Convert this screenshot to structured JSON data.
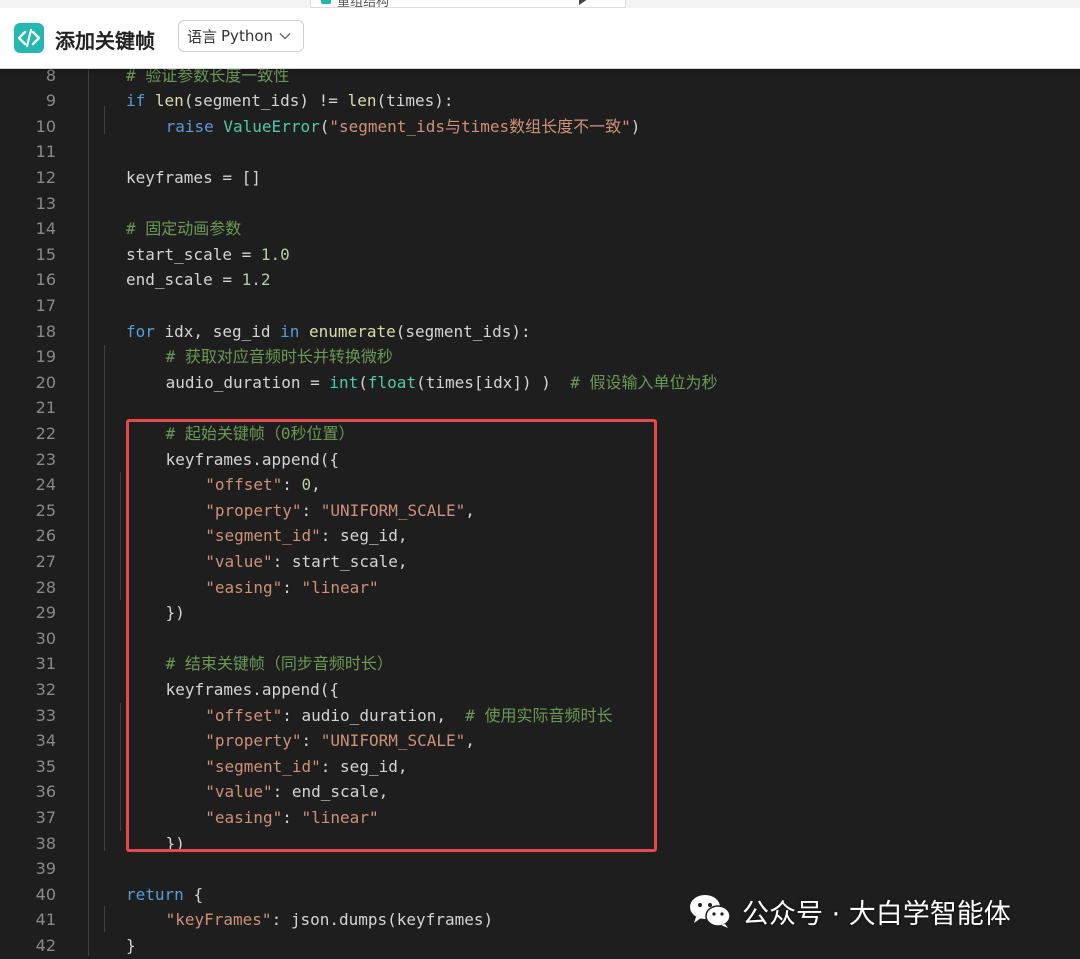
{
  "top_tab": {
    "label": "重组结构"
  },
  "header": {
    "title": "添加关键帧",
    "language_selector": {
      "label": "语言",
      "value": "Python"
    }
  },
  "code_lines": [
    {
      "no": "8",
      "indent": 0,
      "tokens": [
        [
          "cm",
          "# 验证参数长度一致性"
        ]
      ]
    },
    {
      "no": "9",
      "indent": 0,
      "tokens": [
        [
          "kw",
          "if "
        ],
        [
          "fn",
          "len"
        ],
        [
          "tx",
          "(segment_ids) != "
        ],
        [
          "fn",
          "len"
        ],
        [
          "tx",
          "(times):"
        ]
      ]
    },
    {
      "no": "10",
      "indent": 1,
      "tokens": [
        [
          "kw",
          "raise "
        ],
        [
          "cls",
          "ValueError"
        ],
        [
          "tx",
          "("
        ],
        [
          "str",
          "\"segment_ids与times数组长度不一致\""
        ],
        [
          "tx",
          ")"
        ]
      ]
    },
    {
      "no": "11",
      "indent": 0,
      "tokens": []
    },
    {
      "no": "12",
      "indent": 0,
      "tokens": [
        [
          "tx",
          "keyframes = []"
        ]
      ]
    },
    {
      "no": "13",
      "indent": 0,
      "tokens": []
    },
    {
      "no": "14",
      "indent": 0,
      "tokens": [
        [
          "cm",
          "# 固定动画参数"
        ]
      ]
    },
    {
      "no": "15",
      "indent": 0,
      "tokens": [
        [
          "tx",
          "start_scale = "
        ],
        [
          "num",
          "1.0"
        ]
      ]
    },
    {
      "no": "16",
      "indent": 0,
      "tokens": [
        [
          "tx",
          "end_scale = "
        ],
        [
          "num",
          "1.2"
        ]
      ]
    },
    {
      "no": "17",
      "indent": 0,
      "tokens": []
    },
    {
      "no": "18",
      "indent": 0,
      "tokens": [
        [
          "kw",
          "for "
        ],
        [
          "tx",
          "idx, seg_id "
        ],
        [
          "kw",
          "in "
        ],
        [
          "fn",
          "enumerate"
        ],
        [
          "tx",
          "(segment_ids):"
        ]
      ]
    },
    {
      "no": "19",
      "indent": 1,
      "tokens": [
        [
          "cm",
          "# 获取对应音频时长并转换微秒"
        ]
      ]
    },
    {
      "no": "20",
      "indent": 1,
      "tokens": [
        [
          "tx",
          "audio_duration = "
        ],
        [
          "cls",
          "int"
        ],
        [
          "tx",
          "("
        ],
        [
          "cls",
          "float"
        ],
        [
          "tx",
          "(times[idx]) )  "
        ],
        [
          "cm",
          "# 假设输入单位为秒"
        ]
      ]
    },
    {
      "no": "21",
      "indent": 0,
      "tokens": []
    },
    {
      "no": "22",
      "indent": 1,
      "tokens": [
        [
          "cm",
          "# 起始关键帧（0秒位置）"
        ]
      ]
    },
    {
      "no": "23",
      "indent": 1,
      "tokens": [
        [
          "tx",
          "keyframes.append({"
        ]
      ]
    },
    {
      "no": "24",
      "indent": 2,
      "tokens": [
        [
          "str",
          "\"offset\""
        ],
        [
          "tx",
          ": "
        ],
        [
          "num",
          "0"
        ],
        [
          "tx",
          ","
        ]
      ]
    },
    {
      "no": "25",
      "indent": 2,
      "tokens": [
        [
          "str",
          "\"property\""
        ],
        [
          "tx",
          ": "
        ],
        [
          "str",
          "\"UNIFORM_SCALE\""
        ],
        [
          "tx",
          ","
        ]
      ]
    },
    {
      "no": "26",
      "indent": 2,
      "tokens": [
        [
          "str",
          "\"segment_id\""
        ],
        [
          "tx",
          ": seg_id,"
        ]
      ]
    },
    {
      "no": "27",
      "indent": 2,
      "tokens": [
        [
          "str",
          "\"value\""
        ],
        [
          "tx",
          ": start_scale,"
        ]
      ]
    },
    {
      "no": "28",
      "indent": 2,
      "tokens": [
        [
          "str",
          "\"easing\""
        ],
        [
          "tx",
          ": "
        ],
        [
          "str",
          "\"linear\""
        ]
      ]
    },
    {
      "no": "29",
      "indent": 1,
      "tokens": [
        [
          "tx",
          "})"
        ]
      ]
    },
    {
      "no": "30",
      "indent": 0,
      "tokens": []
    },
    {
      "no": "31",
      "indent": 1,
      "tokens": [
        [
          "cm",
          "# 结束关键帧（同步音频时长）"
        ]
      ]
    },
    {
      "no": "32",
      "indent": 1,
      "tokens": [
        [
          "tx",
          "keyframes.append({"
        ]
      ]
    },
    {
      "no": "33",
      "indent": 2,
      "tokens": [
        [
          "str",
          "\"offset\""
        ],
        [
          "tx",
          ": audio_duration,  "
        ],
        [
          "cm",
          "# 使用实际音频时长"
        ]
      ]
    },
    {
      "no": "34",
      "indent": 2,
      "tokens": [
        [
          "str",
          "\"property\""
        ],
        [
          "tx",
          ": "
        ],
        [
          "str",
          "\"UNIFORM_SCALE\""
        ],
        [
          "tx",
          ","
        ]
      ]
    },
    {
      "no": "35",
      "indent": 2,
      "tokens": [
        [
          "str",
          "\"segment_id\""
        ],
        [
          "tx",
          ": seg_id,"
        ]
      ]
    },
    {
      "no": "36",
      "indent": 2,
      "tokens": [
        [
          "str",
          "\"value\""
        ],
        [
          "tx",
          ": end_scale,"
        ]
      ]
    },
    {
      "no": "37",
      "indent": 2,
      "tokens": [
        [
          "str",
          "\"easing\""
        ],
        [
          "tx",
          ": "
        ],
        [
          "str",
          "\"linear\""
        ]
      ]
    },
    {
      "no": "38",
      "indent": 1,
      "tokens": [
        [
          "tx",
          "})"
        ]
      ]
    },
    {
      "no": "39",
      "indent": 0,
      "tokens": []
    },
    {
      "no": "40",
      "indent": 0,
      "tokens": [
        [
          "kw",
          "return "
        ],
        [
          "tx",
          "{"
        ]
      ]
    },
    {
      "no": "41",
      "indent": 1,
      "tokens": [
        [
          "str",
          "\"keyFrames\""
        ],
        [
          "tx",
          ": json.dumps(keyframes)"
        ]
      ]
    },
    {
      "no": "42",
      "indent": 0,
      "tokens": [
        [
          "tx",
          "}"
        ]
      ]
    }
  ],
  "colors": {
    "keyword": "#569cd6",
    "function": "#dcdcaa",
    "class": "#4ec9b0",
    "string": "#ce9178",
    "number": "#b5cea8",
    "comment": "#6a9955",
    "text": "#d4d4d4",
    "highlight_border": "#e5484d",
    "logo": "#25b8b2"
  },
  "watermark": {
    "text": "公众号 · 大白学智能体",
    "icon": "wechat-icon"
  }
}
